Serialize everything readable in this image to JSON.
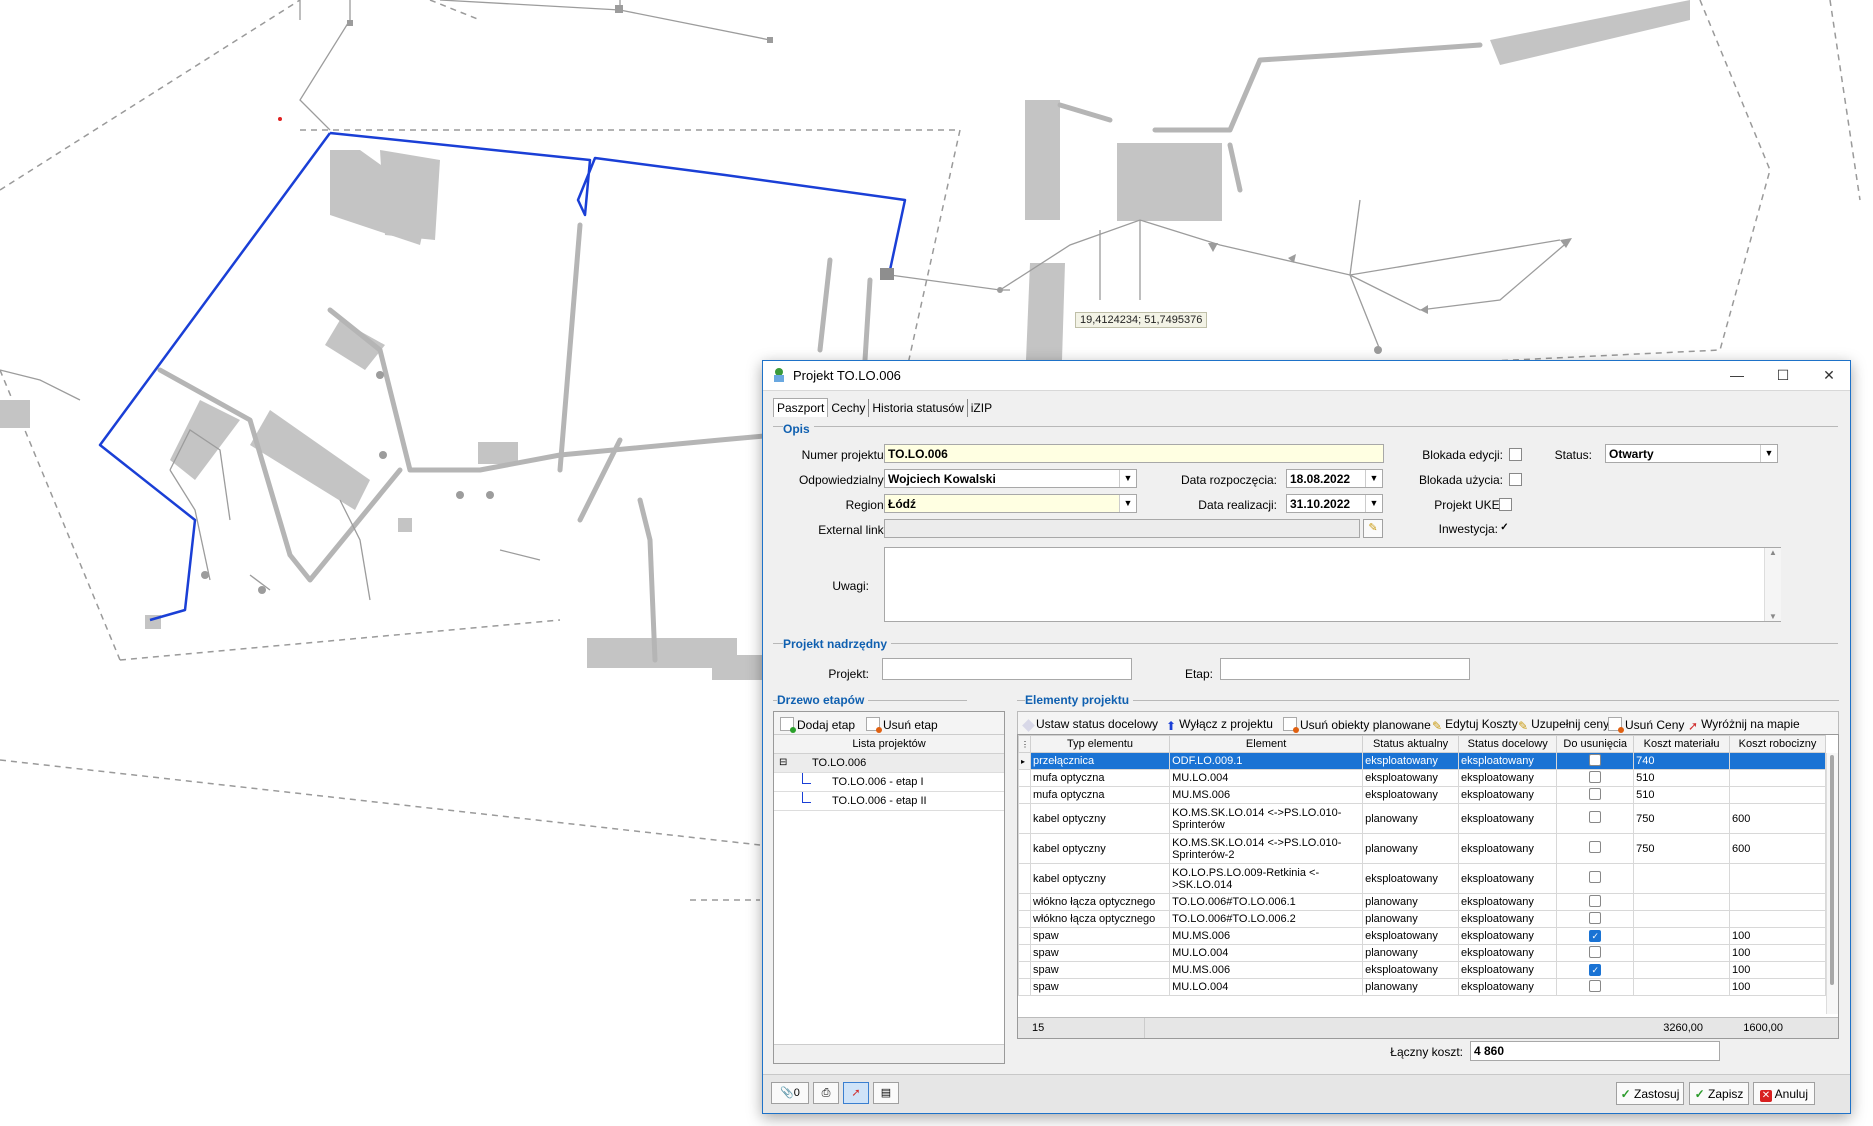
{
  "map": {
    "coordinate_readout": "19,4124234; 51,7495376"
  },
  "dialog": {
    "title": "Projekt TO.LO.006",
    "tabs": [
      "Paszport",
      "Cechy",
      "Historia statusów",
      "iZIP"
    ],
    "opis": {
      "section": "Opis",
      "numer_label": "Numer projektu:",
      "numer_value": "TO.LO.006",
      "odpowiedzialny_label": "Odpowiedzialny:",
      "odpowiedzialny_value": "Wojciech Kowalski",
      "region_label": "Region:",
      "region_value": "Łódź",
      "external_label": "External link:",
      "external_value": "",
      "uwagi_label": "Uwagi:",
      "uwagi_value": "",
      "data_rozp_label": "Data rozpoczęcia:",
      "data_rozp_value": "18.08.2022",
      "data_real_label": "Data realizacji:",
      "data_real_value": "31.10.2022",
      "blokada_edycji_label": "Blokada edycji:",
      "blokada_edycji": false,
      "blokada_uzycia_label": "Blokada użycia:",
      "blokada_uzycia": false,
      "projekt_uke_label": "Projekt UKE:",
      "projekt_uke": false,
      "inwestycja_label": "Inwestycja:",
      "inwestycja": true,
      "status_label": "Status:",
      "status_value": "Otwarty"
    },
    "nadrzedny": {
      "section": "Projekt nadrzędny",
      "projekt_label": "Projekt:",
      "projekt_value": "",
      "etap_label": "Etap:",
      "etap_value": ""
    },
    "drzewo": {
      "section": "Drzewo etapów",
      "add_btn": "Dodaj etap",
      "remove_btn": "Usuń etap",
      "list_header": "Lista projektów",
      "root": "TO.LO.006",
      "children": [
        "TO.LO.006 - etap I",
        "TO.LO.006 - etap II"
      ]
    },
    "elementy": {
      "section": "Elementy projektu",
      "toolbar": [
        "Ustaw status docelowy",
        "Wyłącz z projektu",
        "Usuń obiekty planowane",
        "Edytuj Koszty",
        "Uzupełnij ceny",
        "Usuń Ceny",
        "Wyróżnij na mapie"
      ],
      "columns": [
        "Typ elementu",
        "Element",
        "Status aktualny",
        "Status docelowy",
        "Do usunięcia",
        "Koszt materiału",
        "Koszt robocizny"
      ],
      "rows": [
        {
          "typ": "przełącznica",
          "element": "ODF.LO.009.1",
          "akt": "eksploatowany",
          "doc": "eksploatowany",
          "del": false,
          "mat": "740",
          "rob": ""
        },
        {
          "typ": "mufa optyczna",
          "element": "MU.LO.004",
          "akt": "eksploatowany",
          "doc": "eksploatowany",
          "del": false,
          "mat": "510",
          "rob": ""
        },
        {
          "typ": "mufa optyczna",
          "element": "MU.MS.006",
          "akt": "eksploatowany",
          "doc": "eksploatowany",
          "del": false,
          "mat": "510",
          "rob": ""
        },
        {
          "typ": "kabel optyczny",
          "element": "KO.MS.SK.LO.014 <->PS.LO.010-Sprinterów",
          "akt": "planowany",
          "doc": "eksploatowany",
          "del": false,
          "mat": "750",
          "rob": "600"
        },
        {
          "typ": "kabel optyczny",
          "element": "KO.MS.SK.LO.014 <->PS.LO.010-Sprinterów-2",
          "akt": "planowany",
          "doc": "eksploatowany",
          "del": false,
          "mat": "750",
          "rob": "600"
        },
        {
          "typ": "kabel optyczny",
          "element": "KO.LO.PS.LO.009-Retkinia <->SK.LO.014",
          "akt": "eksploatowany",
          "doc": "eksploatowany",
          "del": false,
          "mat": "",
          "rob": ""
        },
        {
          "typ": "włókno łącza optycznego",
          "element": "TO.LO.006#TO.LO.006.1",
          "akt": "planowany",
          "doc": "eksploatowany",
          "del": false,
          "mat": "",
          "rob": ""
        },
        {
          "typ": "włókno łącza optycznego",
          "element": "TO.LO.006#TO.LO.006.2",
          "akt": "planowany",
          "doc": "eksploatowany",
          "del": false,
          "mat": "",
          "rob": ""
        },
        {
          "typ": "spaw",
          "element": "MU.MS.006",
          "akt": "eksploatowany",
          "doc": "eksploatowany",
          "del": true,
          "mat": "",
          "rob": "100"
        },
        {
          "typ": "spaw",
          "element": "MU.LO.004",
          "akt": "planowany",
          "doc": "eksploatowany",
          "del": false,
          "mat": "",
          "rob": "100"
        },
        {
          "typ": "spaw",
          "element": "MU.MS.006",
          "akt": "eksploatowany",
          "doc": "eksploatowany",
          "del": true,
          "mat": "",
          "rob": "100"
        },
        {
          "typ": "spaw",
          "element": "MU.LO.004",
          "akt": "planowany",
          "doc": "eksploatowany",
          "del": false,
          "mat": "",
          "rob": "100"
        }
      ],
      "footer_count": "15",
      "footer_mat": "3260,00",
      "footer_rob": "1600,00",
      "laczny_label": "Łączny koszt:",
      "laczny_value": "4 860"
    },
    "bottom": {
      "attach_count": "0",
      "zastosuj": "Zastosuj",
      "zapisz": "Zapisz",
      "anuluj": "Anuluj"
    }
  }
}
